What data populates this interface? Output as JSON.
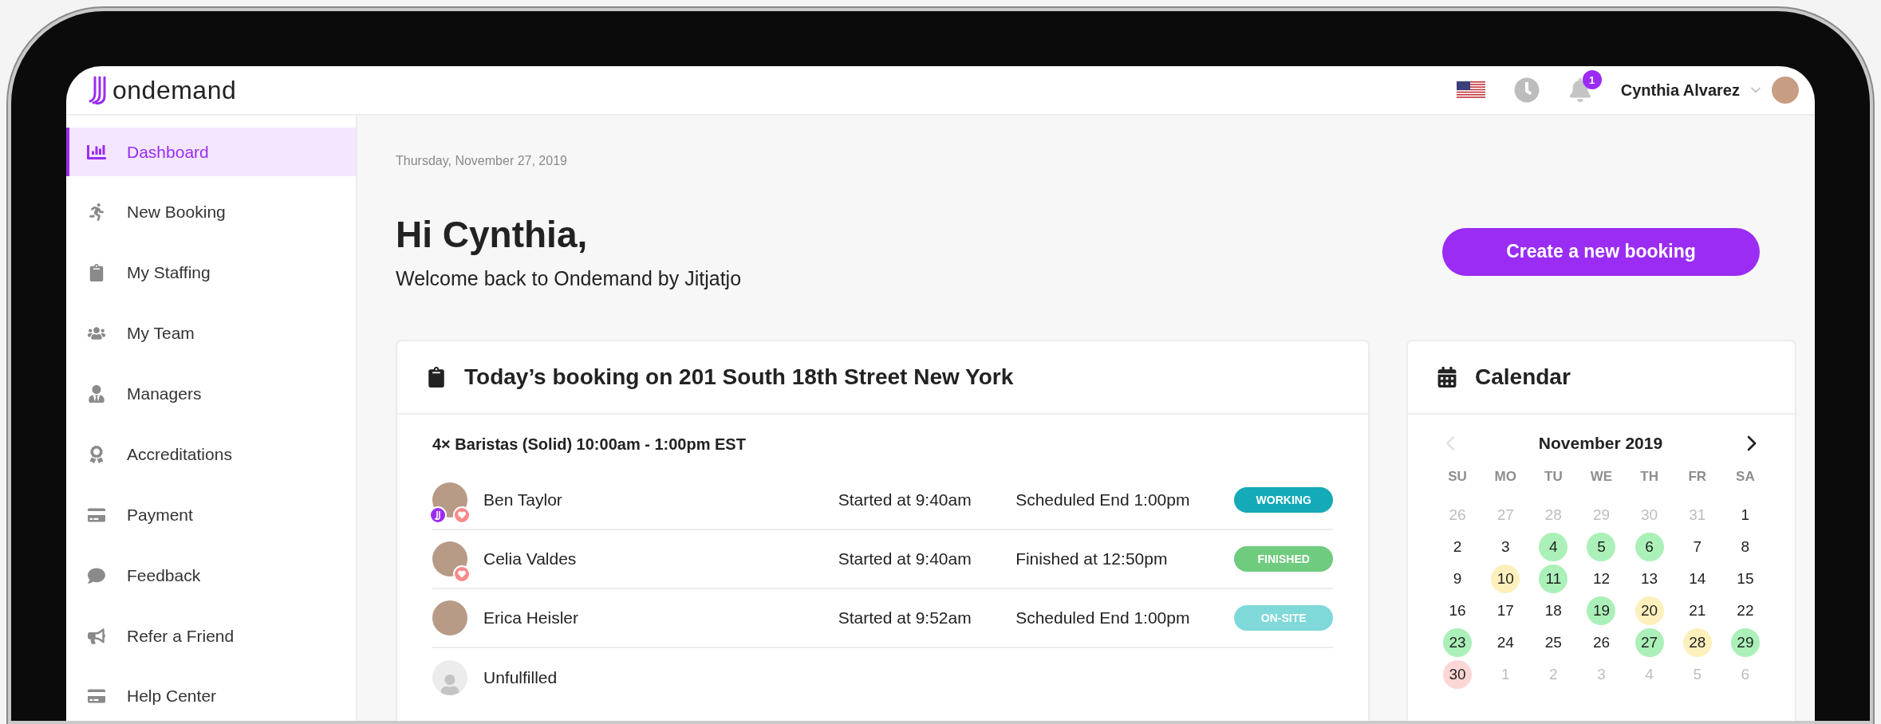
{
  "brand": {
    "name": "ondemand"
  },
  "topbar": {
    "notifications": "1",
    "user_name": "Cynthia Alvarez"
  },
  "sidebar": {
    "items": [
      {
        "label": "Dashboard",
        "selected": true
      },
      {
        "label": "New Booking",
        "selected": false
      },
      {
        "label": "My Staffing",
        "selected": false
      },
      {
        "label": "My Team",
        "selected": false
      },
      {
        "label": "Managers",
        "selected": false
      },
      {
        "label": "Accreditations",
        "selected": false
      },
      {
        "label": "Payment",
        "selected": false
      },
      {
        "label": "Feedback",
        "selected": false
      },
      {
        "label": "Refer a Friend",
        "selected": false
      },
      {
        "label": "Help Center",
        "selected": false
      }
    ]
  },
  "header": {
    "date": "Thursday, November 27, 2019",
    "greeting": "Hi Cynthia,",
    "subtitle": "Welcome back to Ondemand by Jitjatjo",
    "action": "Create a new booking"
  },
  "booking": {
    "title": "Today’s booking on 201 South 18th Street New York",
    "shift": "4× Baristas (Solid) 10:00am - 1:00pm EST",
    "rows": [
      {
        "kind": "worker",
        "name": "Ben Taylor",
        "brand_badge": true,
        "favorite": true,
        "start": "Started at 9:40am",
        "end": "Scheduled End 1:00pm",
        "status": "WORKING",
        "color": "#14aab8"
      },
      {
        "kind": "worker",
        "name": "Celia Valdes",
        "brand_badge": false,
        "favorite": true,
        "start": "Started at 9:40am",
        "end": "Finished at 12:50pm",
        "status": "FINISHED",
        "color": "#6fcb7d"
      },
      {
        "kind": "worker",
        "name": "Erica Heisler",
        "brand_badge": false,
        "favorite": false,
        "start": "Started at 9:52am",
        "end": "Scheduled End 1:00pm",
        "status": "ON-SITE",
        "color": "#7fd9d9"
      },
      {
        "kind": "empty",
        "name": "Unfulfilled"
      }
    ]
  },
  "calendar": {
    "title": "Calendar",
    "month": "November 2019",
    "prev_disabled": true,
    "weekdays": [
      "SU",
      "MO",
      "TU",
      "WE",
      "TH",
      "FR",
      "SA"
    ],
    "weeks": [
      [
        {
          "day": "26",
          "muted": true
        },
        {
          "day": "27",
          "muted": true
        },
        {
          "day": "28",
          "muted": true
        },
        {
          "day": "29",
          "muted": true
        },
        {
          "day": "30",
          "muted": true
        },
        {
          "day": "31",
          "muted": true
        },
        {
          "day": "1",
          "muted": false
        }
      ],
      [
        {
          "day": "2",
          "muted": false
        },
        {
          "day": "3",
          "muted": false
        },
        {
          "day": "4",
          "muted": false,
          "color": "#abf0b8"
        },
        {
          "day": "5",
          "muted": false,
          "color": "#abf0b8"
        },
        {
          "day": "6",
          "muted": false,
          "color": "#abf0b8"
        },
        {
          "day": "7",
          "muted": false
        },
        {
          "day": "8",
          "muted": false
        }
      ],
      [
        {
          "day": "9",
          "muted": false
        },
        {
          "day": "10",
          "muted": false,
          "color": "#fdf0bd"
        },
        {
          "day": "11",
          "muted": false,
          "color": "#abf0b8"
        },
        {
          "day": "12",
          "muted": false
        },
        {
          "day": "13",
          "muted": false
        },
        {
          "day": "14",
          "muted": false
        },
        {
          "day": "15",
          "muted": false
        }
      ],
      [
        {
          "day": "16",
          "muted": false
        },
        {
          "day": "17",
          "muted": false
        },
        {
          "day": "18",
          "muted": false
        },
        {
          "day": "19",
          "muted": false,
          "color": "#abf0b8"
        },
        {
          "day": "20",
          "muted": false,
          "color": "#fdf0bd"
        },
        {
          "day": "21",
          "muted": false
        },
        {
          "day": "22",
          "muted": false
        }
      ],
      [
        {
          "day": "23",
          "muted": false,
          "color": "#abf0b8"
        },
        {
          "day": "24",
          "muted": false
        },
        {
          "day": "25",
          "muted": false
        },
        {
          "day": "26",
          "muted": false
        },
        {
          "day": "27",
          "muted": false,
          "color": "#abf0b8"
        },
        {
          "day": "28",
          "muted": false,
          "color": "#fdf0bd"
        },
        {
          "day": "29",
          "muted": false,
          "color": "#abf0b8"
        }
      ],
      [
        {
          "day": "30",
          "muted": false,
          "color": "#fdd6d6"
        },
        {
          "day": "1",
          "muted": true
        },
        {
          "day": "2",
          "muted": true
        },
        {
          "day": "3",
          "muted": true
        },
        {
          "day": "4",
          "muted": true
        },
        {
          "day": "5",
          "muted": true
        },
        {
          "day": "6",
          "muted": true
        }
      ]
    ]
  }
}
